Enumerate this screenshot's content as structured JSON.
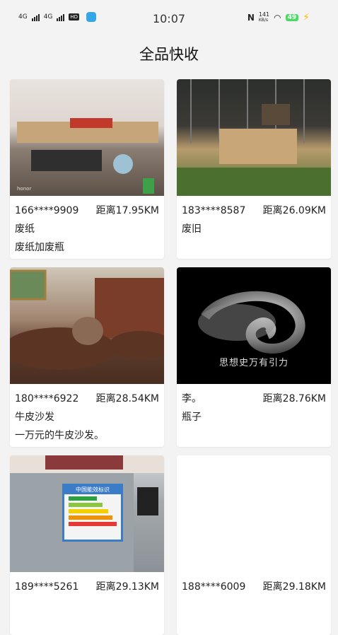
{
  "status_bar": {
    "network1": "4G",
    "network2": "4G",
    "hd": "HD",
    "time": "10:07",
    "nfc": "N",
    "speed": "141",
    "speed_unit": "KB/s",
    "battery": "49"
  },
  "page": {
    "title": "全品快收"
  },
  "items": [
    {
      "phone": "166****9909",
      "distance": "距离17.95KM",
      "category": "废纸",
      "description": "废纸加废瓶",
      "image_watermark": "honor"
    },
    {
      "phone": "183****8587",
      "distance": "距离26.09KM",
      "category": "废旧",
      "description": ""
    },
    {
      "phone": "180****6922",
      "distance": "距离28.54KM",
      "category": "牛皮沙发",
      "description": "一万元的牛皮沙发。"
    },
    {
      "phone": "李。",
      "distance": "距离28.76KM",
      "category": "瓶子",
      "description": "",
      "image_caption": "思想史万有引力"
    },
    {
      "phone": "189****5261",
      "distance": "距离29.13KM",
      "category": "",
      "description": "",
      "label_header": "中国能效标识"
    },
    {
      "phone": "188****6009",
      "distance": "距离29.18KM",
      "category": "",
      "description": ""
    }
  ]
}
